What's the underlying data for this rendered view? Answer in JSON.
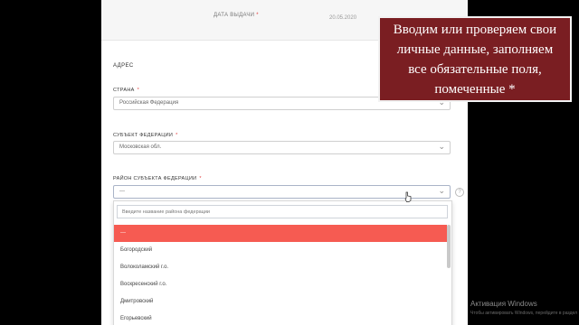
{
  "top": {
    "label": "ДАТА ВЫДАЧИ",
    "required_mark": "*",
    "value": "20.05.2020"
  },
  "address": {
    "section_title": "АДРЕС",
    "country": {
      "label": "СТРАНА",
      "required_mark": "*",
      "value": "Российская Федерация"
    },
    "subject": {
      "label": "СУБЪЕКТ ФЕДЕРАЦИИ",
      "required_mark": "*",
      "value": "Московская обл."
    },
    "district": {
      "label": "РАЙОН СУБЪЕКТА ФЕДЕРАЦИИ",
      "required_mark": "*",
      "value": "---",
      "help": "?"
    }
  },
  "dropdown": {
    "search_placeholder": "Введите название района федерации",
    "items": [
      "---",
      "Богородский",
      "Волоколамский г.о.",
      "Воскресенский г.о.",
      "Дмитровский",
      "Егорьевский"
    ]
  },
  "callout": {
    "lines": [
      "Вводим или проверяем свои",
      "личные данные, заполняем",
      "все обязательные поля,",
      "помеченные *"
    ]
  },
  "watermark": {
    "title": "Активация Windows",
    "subtitle": "Чтобы активировать Windows, перейдите в раздел"
  }
}
